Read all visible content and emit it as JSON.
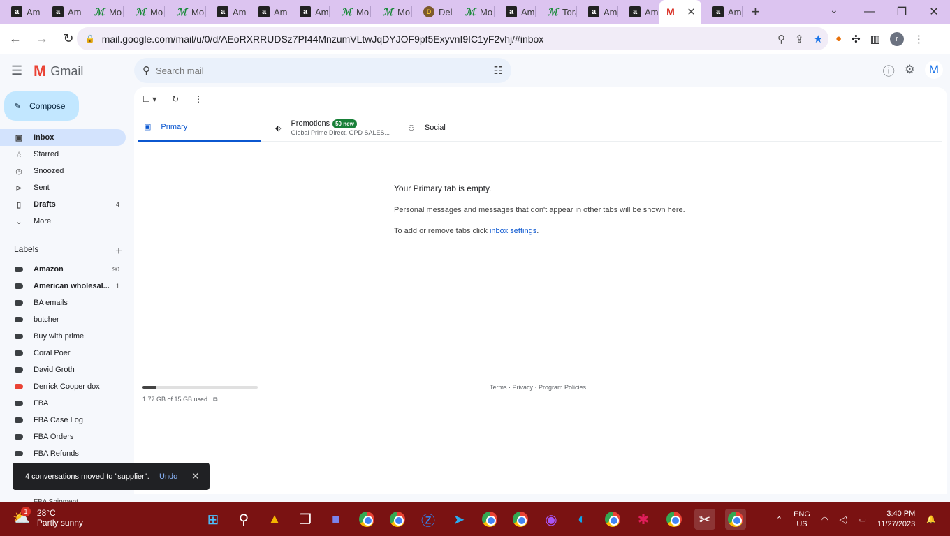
{
  "browser": {
    "tabs": [
      {
        "favicon": "amazon",
        "label": "Am"
      },
      {
        "favicon": "amazon",
        "label": "Am"
      },
      {
        "favicon": "mo",
        "label": "Mo"
      },
      {
        "favicon": "mo",
        "label": "Mo"
      },
      {
        "favicon": "mo",
        "label": "Mo"
      },
      {
        "favicon": "amazon",
        "label": "Am"
      },
      {
        "favicon": "amazon",
        "label": "Am"
      },
      {
        "favicon": "amazon",
        "label": "Am"
      },
      {
        "favicon": "mo",
        "label": "Mo"
      },
      {
        "favicon": "mo",
        "label": "Mo"
      },
      {
        "favicon": "deli",
        "label": "Deli"
      },
      {
        "favicon": "mo",
        "label": "Mo"
      },
      {
        "favicon": "amazon",
        "label": "Am"
      },
      {
        "favicon": "mo",
        "label": "Tora"
      },
      {
        "favicon": "amazon",
        "label": "Am"
      },
      {
        "favicon": "amazon",
        "label": "Am"
      },
      {
        "favicon": "gmail",
        "label": ""
      },
      {
        "favicon": "amazon",
        "label": "Am"
      }
    ],
    "url": "mail.google.com/mail/u/0/d/AEoRXRRUDSz7Pf44MnzumVLtwJqDYJOF9pf5ExyvnI9IC1yF2vhj/#inbox",
    "profile_initial": "r"
  },
  "gmail": {
    "brand": "Gmail",
    "search_placeholder": "Search mail",
    "account_initial": "M",
    "compose_label": "Compose",
    "nav": [
      {
        "label": "Inbox",
        "icon": "inbox-icon",
        "glyph": "▣",
        "count": "",
        "active": true,
        "bold": true
      },
      {
        "label": "Starred",
        "icon": "star-icon",
        "glyph": "☆",
        "count": "",
        "active": false,
        "bold": false
      },
      {
        "label": "Snoozed",
        "icon": "clock-icon",
        "glyph": "◷",
        "count": "",
        "active": false,
        "bold": false
      },
      {
        "label": "Sent",
        "icon": "send-icon",
        "glyph": "⊳",
        "count": "",
        "active": false,
        "bold": false
      },
      {
        "label": "Drafts",
        "icon": "draft-icon",
        "glyph": "▯",
        "count": "4",
        "active": false,
        "bold": true
      },
      {
        "label": "More",
        "icon": "chevron-down-icon",
        "glyph": "⌄",
        "count": "",
        "active": false,
        "bold": false
      }
    ],
    "labels_heading": "Labels",
    "labels": [
      {
        "name": "Amazon",
        "count": "90",
        "bold": true,
        "color": "#3c4043"
      },
      {
        "name": "American wholesal...",
        "count": "1",
        "bold": true,
        "color": "#3c4043"
      },
      {
        "name": "BA emails",
        "count": "",
        "bold": false,
        "color": "#3c4043"
      },
      {
        "name": "butcher",
        "count": "",
        "bold": false,
        "color": "#3c4043"
      },
      {
        "name": "Buy with prime",
        "count": "",
        "bold": false,
        "color": "#3c4043"
      },
      {
        "name": "Coral Poer",
        "count": "",
        "bold": false,
        "color": "#3c4043"
      },
      {
        "name": "David Groth",
        "count": "",
        "bold": false,
        "color": "#3c4043"
      },
      {
        "name": "Derrick Cooper dox",
        "count": "",
        "bold": false,
        "color": "#ea4335"
      },
      {
        "name": "FBA",
        "count": "",
        "bold": false,
        "color": "#3c4043"
      },
      {
        "name": "FBA Case Log",
        "count": "",
        "bold": false,
        "color": "#3c4043"
      },
      {
        "name": "FBA Orders",
        "count": "",
        "bold": false,
        "color": "#3c4043"
      },
      {
        "name": "FBA Refunds",
        "count": "",
        "bold": false,
        "color": "#3c4043"
      }
    ],
    "last_label_partial": "FBA Shipment",
    "tabs": {
      "primary": "Primary",
      "promotions": "Promotions",
      "promotions_badge": "50 new",
      "promotions_senders": "Global Prime Direct, GPD SALES...",
      "social": "Social"
    },
    "empty_state": {
      "title": "Your Primary tab is empty.",
      "line1": "Personal messages and messages that don't appear in other tabs will be shown here.",
      "line2_prefix": "To add or remove tabs click ",
      "line2_link": "inbox settings",
      "line2_suffix": "."
    },
    "storage": {
      "used_text": "1.77 GB of 15 GB used",
      "fraction": 0.118
    },
    "footer": {
      "terms": "Terms",
      "privacy": "Privacy",
      "policies": "Program Policies",
      "sep": " · "
    },
    "snackbar": {
      "message": "4 conversations moved to \"supplier\".",
      "undo": "Undo"
    }
  },
  "taskbar": {
    "temperature": "28°C",
    "condition": "Partly sunny",
    "weather_badge": "1",
    "language": "ENG",
    "region": "US",
    "time": "3:40 PM",
    "date": "11/27/2023"
  }
}
